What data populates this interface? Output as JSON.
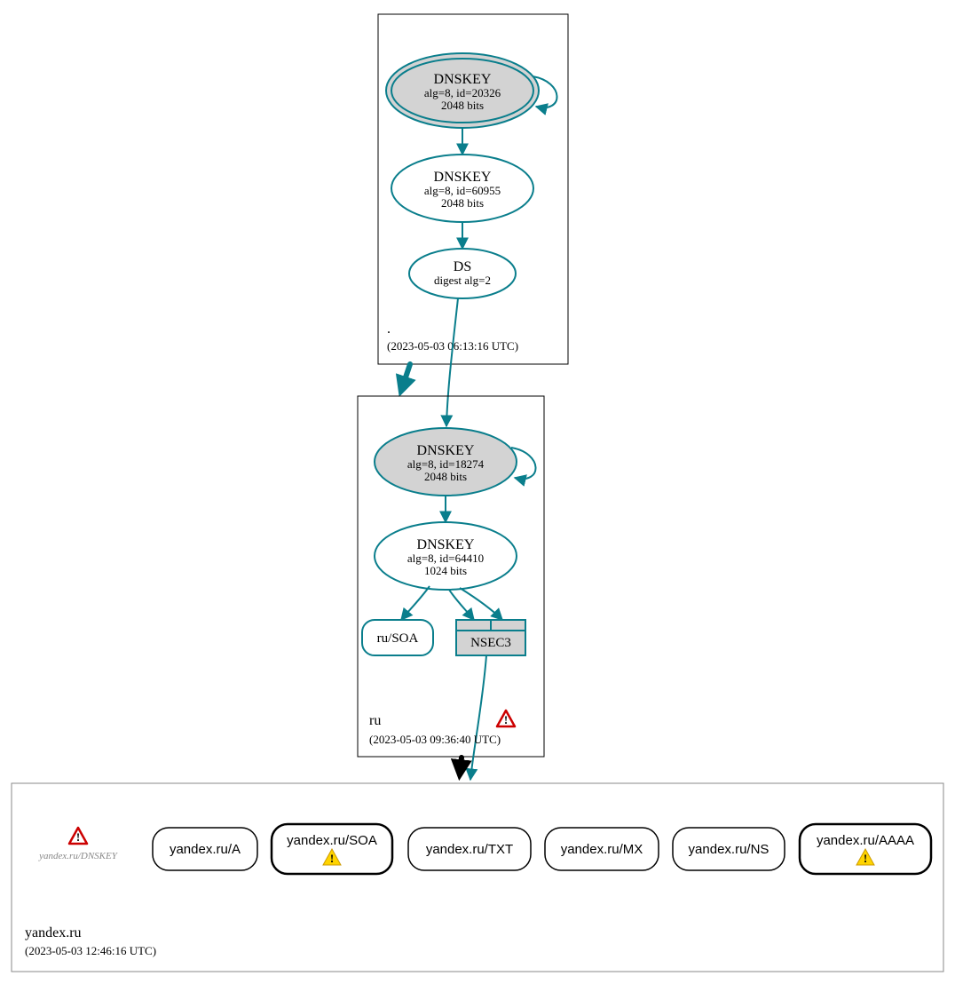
{
  "zones": {
    "root": {
      "label": ".",
      "timestamp": "(2023-05-03 06:13:16 UTC)",
      "ksk": {
        "title": "DNSKEY",
        "line2": "alg=8, id=20326",
        "line3": "2048 bits"
      },
      "zsk": {
        "title": "DNSKEY",
        "line2": "alg=8, id=60955",
        "line3": "2048 bits"
      },
      "ds": {
        "title": "DS",
        "line2": "digest alg=2"
      }
    },
    "ru": {
      "label": "ru",
      "timestamp": "(2023-05-03 09:36:40 UTC)",
      "ksk": {
        "title": "DNSKEY",
        "line2": "alg=8, id=18274",
        "line3": "2048 bits"
      },
      "zsk": {
        "title": "DNSKEY",
        "line2": "alg=8, id=64410",
        "line3": "1024 bits"
      },
      "soa": "ru/SOA",
      "nsec3": "NSEC3"
    },
    "yandex": {
      "label": "yandex.ru",
      "timestamp": "(2023-05-03 12:46:16 UTC)",
      "dnskey_placeholder": "yandex.ru/DNSKEY",
      "rr": {
        "a": "yandex.ru/A",
        "soa": "yandex.ru/SOA",
        "txt": "yandex.ru/TXT",
        "mx": "yandex.ru/MX",
        "ns": "yandex.ru/NS",
        "aaaa": "yandex.ru/AAAA"
      }
    }
  }
}
